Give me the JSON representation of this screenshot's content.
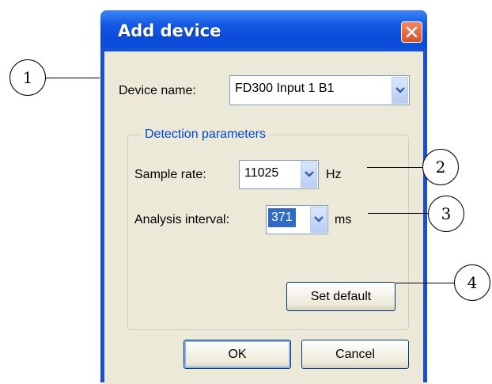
{
  "dialog": {
    "title": "Add device",
    "device_name_label": "Device name:",
    "device_name_value": "FD300 Input 1 B1",
    "group_title": "Detection parameters",
    "sample_rate_label": "Sample rate:",
    "sample_rate_value": "11025",
    "sample_rate_unit": "Hz",
    "analysis_interval_label": "Analysis interval:",
    "analysis_interval_value": "371",
    "analysis_interval_unit": "ms",
    "set_default_label": "Set default",
    "ok_label": "OK",
    "cancel_label": "Cancel"
  },
  "callouts": [
    "1",
    "2",
    "3",
    "4"
  ],
  "colors": {
    "title_bar": "#0a4bd8",
    "dialog_face": "#ece9d8",
    "group_title": "#0046d5",
    "selection": "#316ac5",
    "close_button": "#d8502e"
  },
  "icons": {
    "close": "close-icon",
    "dropdown": "chevron-down-icon"
  }
}
